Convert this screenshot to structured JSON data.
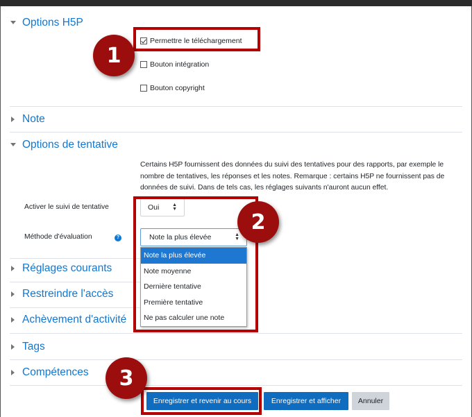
{
  "sections": {
    "h5p_options": {
      "title": "Options H5P"
    },
    "grade": {
      "title": "Note"
    },
    "attempt_options": {
      "title": "Options de tentative"
    },
    "common_settings": {
      "title": "Réglages courants"
    },
    "restrict_access": {
      "title": "Restreindre l'accès"
    },
    "activity_completion": {
      "title": "Achèvement d'activité"
    },
    "tags": {
      "title": "Tags"
    },
    "competencies": {
      "title": "Compétences"
    }
  },
  "h5p_options": {
    "allow_download": {
      "label": "Permettre le téléchargement",
      "checked": true
    },
    "embed_button": {
      "label": "Bouton intégration",
      "checked": false
    },
    "copyright_button": {
      "label": "Bouton copyright",
      "checked": false
    }
  },
  "attempt_options": {
    "description": "Certains H5P fournissent des données du suivi des tentatives pour des rapports, par exemple le nombre de tentatives, les réponses et les notes. Remarque : certains H5P ne fournissent pas de données de suivi. Dans de tels cas, les réglages suivants n'auront aucun effet.",
    "tracking_label": "Activer le suivi de tentative",
    "tracking_value": "Oui",
    "grading_label": "Méthode d'évaluation",
    "grading_value": "Note la plus élevée",
    "grading_options": [
      "Note la plus élevée",
      "Note moyenne",
      "Dernière tentative",
      "Première tentative",
      "Ne pas calculer une note"
    ]
  },
  "buttons": {
    "save_return": "Enregistrer et revenir au cours",
    "save_display": "Enregistrer et afficher",
    "cancel": "Annuler"
  },
  "callouts": [
    "1",
    "2",
    "3"
  ],
  "colors": {
    "link": "#1177d1",
    "primary_button": "#0f6cbf",
    "highlight": "#b30000",
    "badge": "#9c0e0e"
  }
}
